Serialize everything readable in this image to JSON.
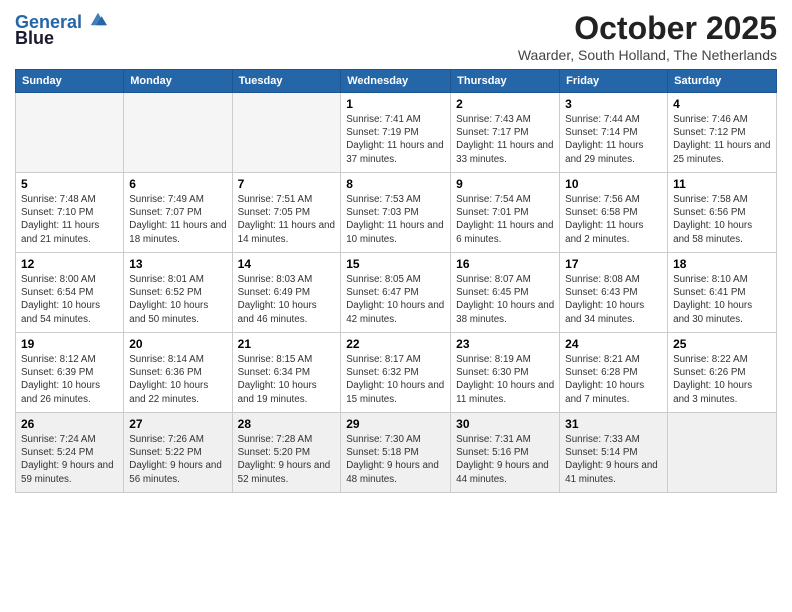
{
  "brand": {
    "line1": "General",
    "line2": "Blue"
  },
  "title": "October 2025",
  "subtitle": "Waarder, South Holland, The Netherlands",
  "days_of_week": [
    "Sunday",
    "Monday",
    "Tuesday",
    "Wednesday",
    "Thursday",
    "Friday",
    "Saturday"
  ],
  "weeks": [
    [
      {
        "num": "",
        "info": ""
      },
      {
        "num": "",
        "info": ""
      },
      {
        "num": "",
        "info": ""
      },
      {
        "num": "1",
        "info": "Sunrise: 7:41 AM\nSunset: 7:19 PM\nDaylight: 11 hours and 37 minutes."
      },
      {
        "num": "2",
        "info": "Sunrise: 7:43 AM\nSunset: 7:17 PM\nDaylight: 11 hours and 33 minutes."
      },
      {
        "num": "3",
        "info": "Sunrise: 7:44 AM\nSunset: 7:14 PM\nDaylight: 11 hours and 29 minutes."
      },
      {
        "num": "4",
        "info": "Sunrise: 7:46 AM\nSunset: 7:12 PM\nDaylight: 11 hours and 25 minutes."
      }
    ],
    [
      {
        "num": "5",
        "info": "Sunrise: 7:48 AM\nSunset: 7:10 PM\nDaylight: 11 hours and 21 minutes."
      },
      {
        "num": "6",
        "info": "Sunrise: 7:49 AM\nSunset: 7:07 PM\nDaylight: 11 hours and 18 minutes."
      },
      {
        "num": "7",
        "info": "Sunrise: 7:51 AM\nSunset: 7:05 PM\nDaylight: 11 hours and 14 minutes."
      },
      {
        "num": "8",
        "info": "Sunrise: 7:53 AM\nSunset: 7:03 PM\nDaylight: 11 hours and 10 minutes."
      },
      {
        "num": "9",
        "info": "Sunrise: 7:54 AM\nSunset: 7:01 PM\nDaylight: 11 hours and 6 minutes."
      },
      {
        "num": "10",
        "info": "Sunrise: 7:56 AM\nSunset: 6:58 PM\nDaylight: 11 hours and 2 minutes."
      },
      {
        "num": "11",
        "info": "Sunrise: 7:58 AM\nSunset: 6:56 PM\nDaylight: 10 hours and 58 minutes."
      }
    ],
    [
      {
        "num": "12",
        "info": "Sunrise: 8:00 AM\nSunset: 6:54 PM\nDaylight: 10 hours and 54 minutes."
      },
      {
        "num": "13",
        "info": "Sunrise: 8:01 AM\nSunset: 6:52 PM\nDaylight: 10 hours and 50 minutes."
      },
      {
        "num": "14",
        "info": "Sunrise: 8:03 AM\nSunset: 6:49 PM\nDaylight: 10 hours and 46 minutes."
      },
      {
        "num": "15",
        "info": "Sunrise: 8:05 AM\nSunset: 6:47 PM\nDaylight: 10 hours and 42 minutes."
      },
      {
        "num": "16",
        "info": "Sunrise: 8:07 AM\nSunset: 6:45 PM\nDaylight: 10 hours and 38 minutes."
      },
      {
        "num": "17",
        "info": "Sunrise: 8:08 AM\nSunset: 6:43 PM\nDaylight: 10 hours and 34 minutes."
      },
      {
        "num": "18",
        "info": "Sunrise: 8:10 AM\nSunset: 6:41 PM\nDaylight: 10 hours and 30 minutes."
      }
    ],
    [
      {
        "num": "19",
        "info": "Sunrise: 8:12 AM\nSunset: 6:39 PM\nDaylight: 10 hours and 26 minutes."
      },
      {
        "num": "20",
        "info": "Sunrise: 8:14 AM\nSunset: 6:36 PM\nDaylight: 10 hours and 22 minutes."
      },
      {
        "num": "21",
        "info": "Sunrise: 8:15 AM\nSunset: 6:34 PM\nDaylight: 10 hours and 19 minutes."
      },
      {
        "num": "22",
        "info": "Sunrise: 8:17 AM\nSunset: 6:32 PM\nDaylight: 10 hours and 15 minutes."
      },
      {
        "num": "23",
        "info": "Sunrise: 8:19 AM\nSunset: 6:30 PM\nDaylight: 10 hours and 11 minutes."
      },
      {
        "num": "24",
        "info": "Sunrise: 8:21 AM\nSunset: 6:28 PM\nDaylight: 10 hours and 7 minutes."
      },
      {
        "num": "25",
        "info": "Sunrise: 8:22 AM\nSunset: 6:26 PM\nDaylight: 10 hours and 3 minutes."
      }
    ],
    [
      {
        "num": "26",
        "info": "Sunrise: 7:24 AM\nSunset: 5:24 PM\nDaylight: 9 hours and 59 minutes."
      },
      {
        "num": "27",
        "info": "Sunrise: 7:26 AM\nSunset: 5:22 PM\nDaylight: 9 hours and 56 minutes."
      },
      {
        "num": "28",
        "info": "Sunrise: 7:28 AM\nSunset: 5:20 PM\nDaylight: 9 hours and 52 minutes."
      },
      {
        "num": "29",
        "info": "Sunrise: 7:30 AM\nSunset: 5:18 PM\nDaylight: 9 hours and 48 minutes."
      },
      {
        "num": "30",
        "info": "Sunrise: 7:31 AM\nSunset: 5:16 PM\nDaylight: 9 hours and 44 minutes."
      },
      {
        "num": "31",
        "info": "Sunrise: 7:33 AM\nSunset: 5:14 PM\nDaylight: 9 hours and 41 minutes."
      },
      {
        "num": "",
        "info": ""
      }
    ]
  ]
}
